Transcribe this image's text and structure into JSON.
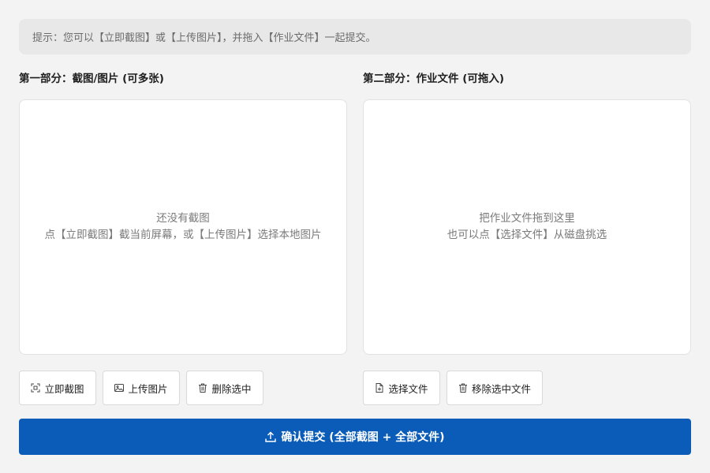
{
  "hint": "提示：您可以【立即截图】或【上传图片】，并拖入【作业文件】一起提交。",
  "section1": {
    "title": "第一部分：截图/图片 (可多张)",
    "empty_line1": "还没有截图",
    "empty_line2": "点【立即截图】截当前屏幕，或【上传图片】选择本地图片"
  },
  "section2": {
    "title": "第二部分：作业文件 (可拖入)",
    "empty_line1": "把作业文件拖到这里",
    "empty_line2": "也可以点【选择文件】从磁盘挑选"
  },
  "buttons": {
    "screenshot": "立即截图",
    "upload_image": "上传图片",
    "delete_selected": "删除选中",
    "choose_file": "选择文件",
    "remove_selected_file": "移除选中文件"
  },
  "submit": {
    "label": "确认提交 (全部截图 + 全部文件)"
  },
  "icons": {
    "screenshot": "screenshot-icon",
    "image": "image-icon",
    "trash": "trash-icon",
    "file_add": "file-add-icon",
    "upload": "upload-icon"
  },
  "colors": {
    "accent": "#0a5cb8",
    "background": "#f3f3f3",
    "hint_background": "#e8e8e8"
  }
}
